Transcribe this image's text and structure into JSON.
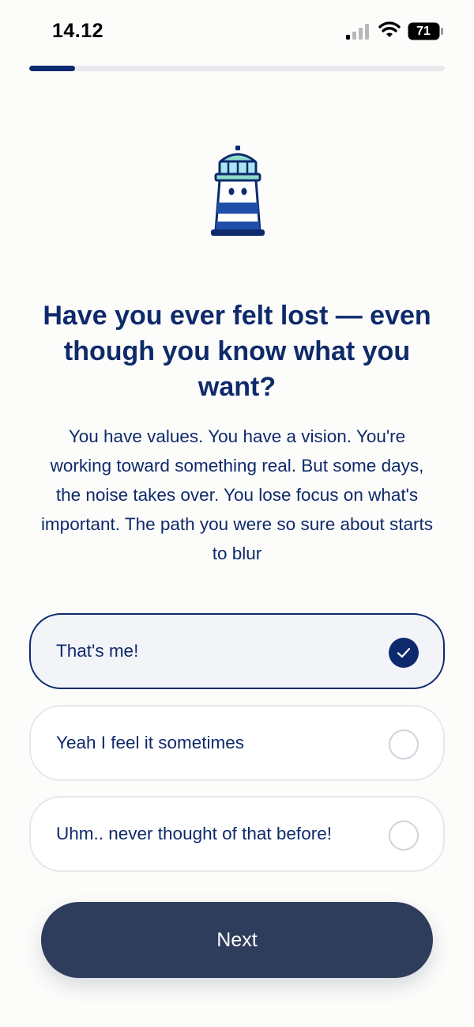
{
  "status_bar": {
    "time": "14.12",
    "battery": "71"
  },
  "progress": {
    "fraction": 0.11
  },
  "question": {
    "title": "Have you ever felt lost — even though you know what you want?",
    "body": "You have values. You have a vision. You're working toward something real. But some days, the noise takes over. You lose focus on what's important. The path you were so sure about starts to blur"
  },
  "options": [
    {
      "label": "That's me!",
      "selected": true
    },
    {
      "label": "Yeah I feel it sometimes",
      "selected": false
    },
    {
      "label": "Uhm.. never thought of that before!",
      "selected": false
    }
  ],
  "next_label": "Next",
  "colors": {
    "primary_navy": "#0e2a6e",
    "button_bg": "#2e3d5b",
    "lighthouse_teal": "#8fdcc8"
  }
}
